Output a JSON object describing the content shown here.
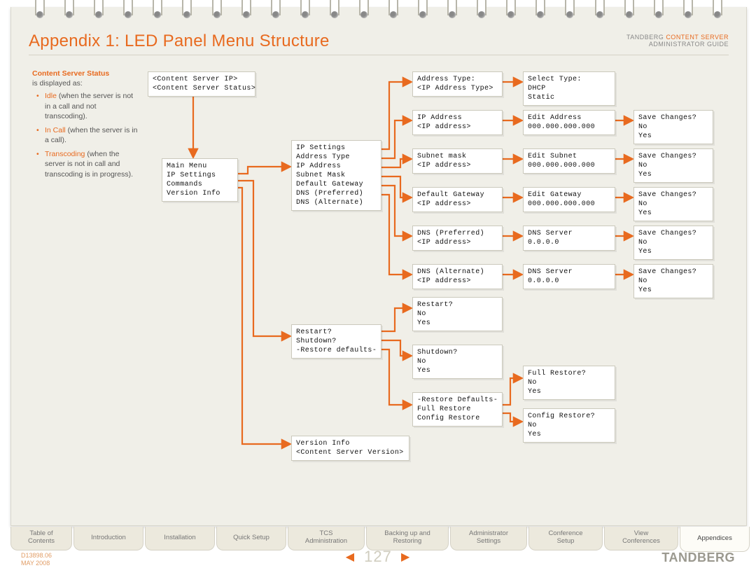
{
  "title": "Appendix 1: LED Panel Menu Structure",
  "header": {
    "brand_left": "TANDBERG ",
    "brand_right": "CONTENT SERVER",
    "sub": "ADMINISTRATOR GUIDE"
  },
  "legend": {
    "heading": "Content Server Status",
    "intro": "is displayed as:",
    "items": [
      {
        "kw": "Idle",
        "rest": " (when the server is not in a call and not transcoding)."
      },
      {
        "kw": "In Call",
        "rest": " (when the server is in a call)."
      },
      {
        "kw": "Transcoding",
        "rest": " (when the server is not in call and transcoding is in progress)."
      }
    ]
  },
  "boxes": {
    "b_status": "<Content Server IP>\n<Content Server Status>",
    "b_main": "Main Menu\nIP Settings\nCommands\nVersion Info",
    "b_ip": "IP Settings\nAddress Type\nIP Address\nSubnet Mask\nDefault Gateway\nDNS (Preferred)\nDNS (Alternate)",
    "b_at": "Address Type:\n<IP Address Type>",
    "b_sel": "Select Type:\nDHCP\nStatic",
    "b_ipa": "IP Address\n<IP address>",
    "b_ea": "Edit Address\n000.000.000.000",
    "b_sc1": "Save Changes?\nNo\nYes",
    "b_sm": "Subnet mask\n<IP address>",
    "b_es": "Edit Subnet\n000.000.000.000",
    "b_sc2": "Save Changes?\nNo\nYes",
    "b_dg": "Default Gateway\n<IP address>",
    "b_eg": "Edit Gateway\n000.000.000.000",
    "b_sc3": "Save Changes?\nNo\nYes",
    "b_dp": "DNS (Preferred)\n<IP address>",
    "b_ds1": "DNS Server\n0.0.0.0",
    "b_sc4": "Save Changes?\nNo\nYes",
    "b_da": "DNS (Alternate)\n<IP address>",
    "b_ds2": "DNS Server\n0.0.0.0",
    "b_sc5": "Save Changes?\nNo\nYes",
    "b_cmds": "Restart?\nShutdown?\n-Restore defaults-",
    "b_r": "Restart?\nNo\nYes",
    "b_sd": "Shutdown?\nNo\nYes",
    "b_rd": "-Restore Defaults-\nFull Restore\nConfig Restore",
    "b_fr": "Full Restore?\nNo\nYes",
    "b_cr": "Config Restore?\nNo\nYes",
    "b_vi": "Version Info\n<Content Server Version>"
  },
  "tabs": [
    "Table of\nContents",
    "Introduction",
    "Installation",
    "Quick Setup",
    "TCS\nAdministration",
    "Backing up and\nRestoring",
    "Administrator\nSettings",
    "Conference\nSetup",
    "View\nConferences",
    "Appendices"
  ],
  "active_tab_index": 9,
  "footer": {
    "doc": "D13898.06",
    "date": "MAY 2008",
    "page": "127",
    "brand": "TANDBERG"
  }
}
